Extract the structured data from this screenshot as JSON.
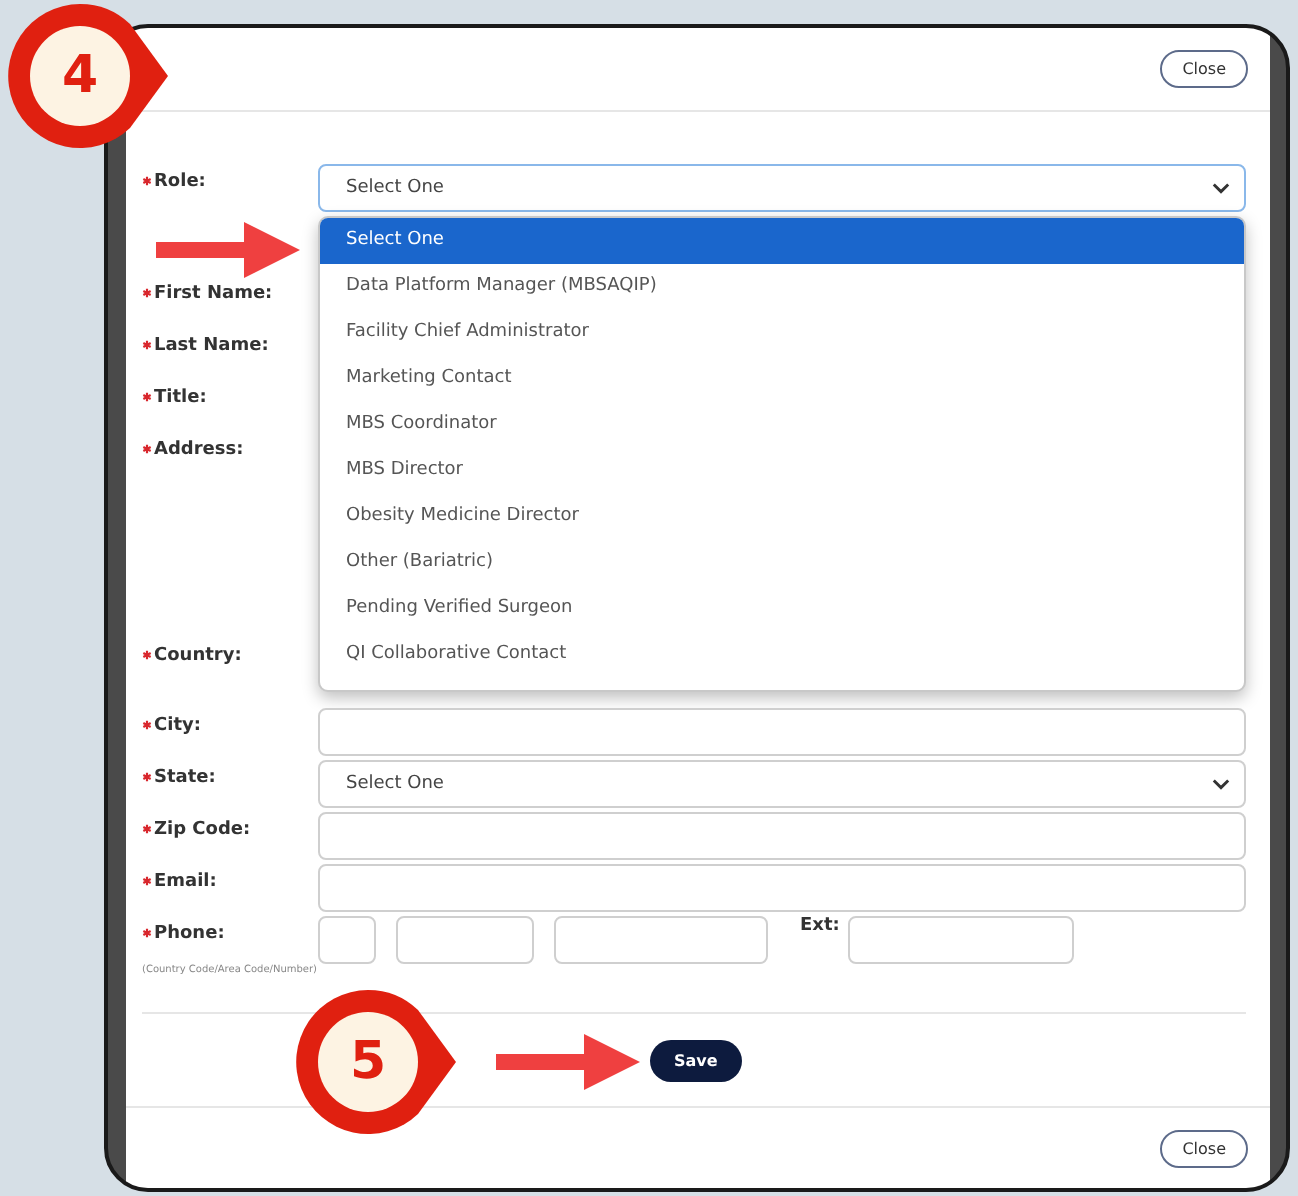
{
  "step_markers": [
    {
      "number": "4"
    },
    {
      "number": "5"
    }
  ],
  "modal": {
    "close_buttons": [
      "Close",
      "Close"
    ],
    "role": {
      "label": "Role:",
      "required": true,
      "value": "Select One",
      "focused": true,
      "options": [
        {
          "label": "Select One",
          "selected": true
        },
        {
          "label": "Data Platform Manager (MBSAQIP)",
          "selected": false
        },
        {
          "label": "Facility Chief Administrator",
          "selected": false
        },
        {
          "label": "Marketing Contact",
          "selected": false
        },
        {
          "label": "MBS Coordinator",
          "selected": false
        },
        {
          "label": "MBS Director",
          "selected": false
        },
        {
          "label": "Obesity Medicine Director",
          "selected": false
        },
        {
          "label": "Other (Bariatric)",
          "selected": false
        },
        {
          "label": "Pending Verified Surgeon",
          "selected": false
        },
        {
          "label": "QI Collaborative Contact",
          "selected": false
        }
      ]
    },
    "labels_beside_list": [
      {
        "label": "First Name:",
        "required": true,
        "kind": "line"
      },
      {
        "label": "Last Name:",
        "required": true,
        "kind": "line"
      },
      {
        "label": "Title:",
        "required": true,
        "kind": "line"
      },
      {
        "label": "Address:",
        "required": true,
        "kind": "tall"
      },
      {
        "label": "Country:",
        "required": true,
        "kind": "line"
      }
    ],
    "fields": [
      {
        "label": "City:",
        "required": true,
        "kind": "text"
      },
      {
        "label": "State:",
        "required": true,
        "kind": "select",
        "value": "Select One"
      },
      {
        "label": "Zip Code:",
        "required": true,
        "kind": "text"
      },
      {
        "label": "Email:",
        "required": true,
        "kind": "text"
      },
      {
        "label": "Phone:",
        "required": true,
        "kind": "phone",
        "ext_label": "Ext:",
        "hint": "(Country Code/Area Code/Number)"
      }
    ],
    "save_button": "Save"
  }
}
